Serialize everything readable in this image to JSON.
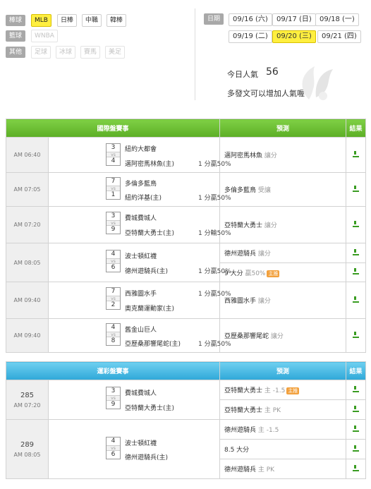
{
  "filters": {
    "rows": [
      {
        "label": "棒球",
        "chips": [
          {
            "text": "MLB",
            "state": "selected"
          },
          {
            "text": "日棒",
            "state": "normal"
          },
          {
            "text": "中職",
            "state": "normal"
          },
          {
            "text": "韓棒",
            "state": "normal"
          }
        ]
      },
      {
        "label": "籃球",
        "chips": [
          {
            "text": "WNBA",
            "state": "disabled"
          }
        ]
      },
      {
        "label": "其他",
        "chips": [
          {
            "text": "足球",
            "state": "disabled"
          },
          {
            "text": "冰球",
            "state": "disabled"
          },
          {
            "text": "賽馬",
            "state": "disabled"
          },
          {
            "text": "美足",
            "state": "disabled"
          }
        ]
      }
    ],
    "date_label": "日期",
    "dates": [
      "09/16 (六)",
      "09/17 (日)",
      "09/18 (一)",
      "09/19 (二)",
      "09/20 (三)",
      "09/21 (四)"
    ],
    "selected_date": "09/20 (三)"
  },
  "popularity": {
    "label": "今日人氣",
    "count": "56",
    "note": "多發文可以增加人氣喔~"
  },
  "intl_table": {
    "headers": [
      "國際盤賽事",
      "預測",
      "結果"
    ],
    "rows": [
      {
        "time": "AM 06:40",
        "score_away": "3",
        "score_home": "4",
        "vs": "vs",
        "away": "紐約大都會",
        "home": "邁阿密馬林魚(主)",
        "history": "1 分贏50%",
        "history_row": "home",
        "preds": [
          {
            "text": "邁阿密馬林魚",
            "extra": "讓分"
          }
        ]
      },
      {
        "time": "AM 07:05",
        "score_away": "7",
        "score_home": "1",
        "vs": "vs",
        "away": "多倫多藍鳥",
        "home": "紐約洋基(主)",
        "history": "1 分贏50%",
        "history_row": "home",
        "preds": [
          {
            "text": "多倫多藍鳥",
            "extra": "受讓"
          }
        ]
      },
      {
        "time": "AM 07:20",
        "score_away": "3",
        "score_home": "9",
        "vs": "vs",
        "away": "費城費城人",
        "home": "亞特蘭大勇士(主)",
        "history": "1 分輸50%",
        "history_row": "home",
        "preds": [
          {
            "text": "亞特蘭大勇士",
            "extra": "讓分"
          }
        ]
      },
      {
        "time": "AM 08:05",
        "score_away": "4",
        "score_home": "6",
        "vs": "vs",
        "away": "波士頓紅襪",
        "home": "德州遊騎兵(主)",
        "history": "1 分贏50%",
        "history_row": "home",
        "preds": [
          {
            "text": "德州遊騎兵",
            "extra": "讓分"
          },
          {
            "text": "9 大分",
            "extra": "贏50%",
            "badge": "主推"
          }
        ]
      },
      {
        "time": "AM 09:40",
        "score_away": "7",
        "score_home": "2",
        "vs": "vs",
        "away": "西雅圖水手",
        "home": "奧克蘭運動家(主)",
        "history": "1 分贏50%",
        "history_row": "away",
        "preds": [
          {
            "text": "西雅圖水手",
            "extra": "讓分"
          }
        ]
      },
      {
        "time": "AM 09:40",
        "score_away": "4",
        "score_home": "8",
        "vs": "vs",
        "away": "舊金山巨人",
        "home": "亞歷桑那響尾蛇(主)",
        "history": "1 分贏50%",
        "history_row": "home",
        "preds": [
          {
            "text": "亞歷桑那響尾蛇",
            "extra": "讓分"
          }
        ]
      }
    ]
  },
  "lottery_table": {
    "headers": [
      "運彩盤賽事",
      "預測",
      "結果"
    ],
    "rows": [
      {
        "num": "285",
        "time": "AM 07:20",
        "score_away": "3",
        "score_home": "9",
        "vs": "vs",
        "away": "費城費城人",
        "home": "亞特蘭大勇士(主)",
        "preds": [
          {
            "text": "亞特蘭大勇士",
            "extra": "主 -1.5",
            "badge": "主推"
          },
          {
            "text": "亞特蘭大勇士",
            "extra": "主 PK"
          }
        ]
      },
      {
        "num": "289",
        "time": "AM 08:05",
        "score_away": "4",
        "score_home": "6",
        "vs": "vs",
        "away": "波士頓紅襪",
        "home": "德州遊騎兵(主)",
        "preds": [
          {
            "text": "德州遊騎兵",
            "extra": "主 -1.5"
          },
          {
            "text": "8.5 大分",
            "extra": ""
          },
          {
            "text": "德州遊騎兵",
            "extra": "主 PK"
          }
        ]
      }
    ]
  },
  "colors": {
    "intl_header": "#6cbe30",
    "lottery_header": "#3ab4e0",
    "selected": "#ffef40",
    "win_icon": "#3a9c22"
  },
  "icons": {
    "result": "win-icon",
    "decor": "wing-decoration"
  }
}
